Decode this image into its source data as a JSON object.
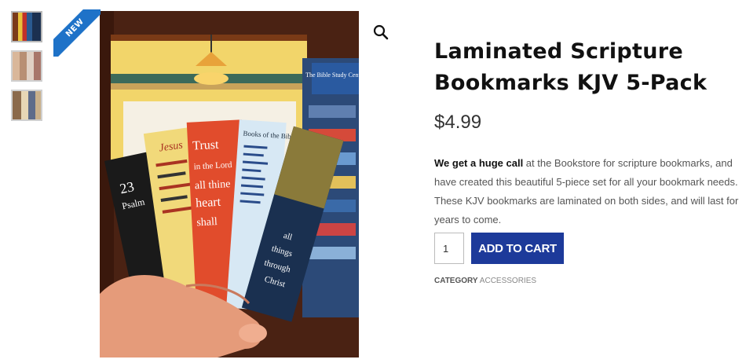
{
  "product": {
    "badge": "NEW",
    "title": "Laminated Scripture Bookmarks KJV 5-Pack",
    "price": "$4.99",
    "description_bold": "We get a huge call",
    "description_rest": " at the Bookstore for scripture bookmarks, and have created this beautiful 5-piece set for all your bookmark needs. These KJV bookmarks are laminated on both sides, and will last for years to come.",
    "quantity": "1",
    "add_to_cart_label": "ADD TO CART",
    "category_label": "CATEGORY",
    "category_value": "ACCESSORIES"
  },
  "gallery": {
    "thumbnail_count": 3,
    "bookmark_texts": [
      "23 Psalm",
      "Jesus",
      "Trust in the Lord with all thine heart and he shall direct thy",
      "Books of the Bible",
      "I can do all things through Christ which strengtheneth me"
    ],
    "shelf_sign": "The Bible Study Center"
  },
  "colors": {
    "button": "#1d3a9a",
    "badge": "#1e72c8"
  }
}
